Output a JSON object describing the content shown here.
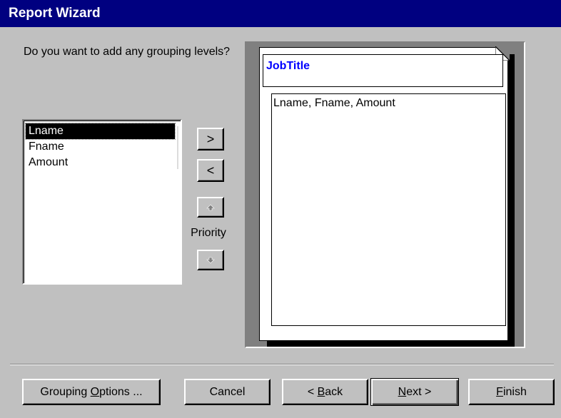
{
  "window": {
    "title": "Report Wizard"
  },
  "prompt": "Do you want to add any grouping levels?",
  "field_list": {
    "items": [
      {
        "label": "Lname",
        "selected": true
      },
      {
        "label": "Fname",
        "selected": false
      },
      {
        "label": "Amount",
        "selected": false
      }
    ]
  },
  "controls": {
    "add_label": ">",
    "remove_label": "<",
    "priority_label": "Priority",
    "priority_up_icon": "arrow-up-icon",
    "priority_down_icon": "arrow-down-icon"
  },
  "preview": {
    "group_header": "JobTitle",
    "detail_fields": "Lname, Fname, Amount"
  },
  "footer": {
    "grouping_options": {
      "pre": "Grouping ",
      "ul": "O",
      "post": "ptions ..."
    },
    "cancel": "Cancel",
    "back": {
      "pre": "< ",
      "ul": "B",
      "post": "ack"
    },
    "next": {
      "pre": "",
      "ul": "N",
      "post": "ext >"
    },
    "finish": {
      "pre": "",
      "ul": "F",
      "post": "inish"
    }
  },
  "colors": {
    "title_bar": "#000080",
    "group_label": "#0000ff",
    "selection": "#000000",
    "face": "#c0c0c0"
  }
}
